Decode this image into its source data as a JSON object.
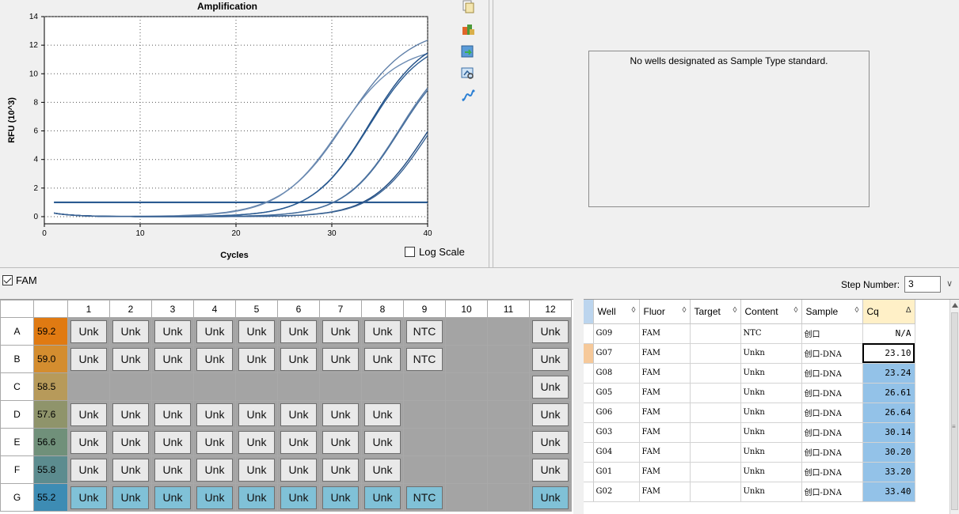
{
  "chart_data": {
    "type": "line",
    "title": "Amplification",
    "xlabel": "Cycles",
    "ylabel": "RFU (10^3)",
    "xlim": [
      0,
      40
    ],
    "ylim": [
      -0.5,
      14
    ],
    "x_ticks": [
      0,
      10,
      20,
      30,
      40
    ],
    "y_ticks": [
      0,
      2,
      4,
      6,
      8,
      10,
      12,
      14
    ],
    "threshold": 1.0,
    "grid": true,
    "series": [
      {
        "cq": 23.1,
        "plateau": 13.3,
        "k": 0.3,
        "color": "#5f7fa8"
      },
      {
        "cq": 23.24,
        "plateau": 12.0,
        "k": 0.32,
        "color": "#6d8cb3"
      },
      {
        "cq": 26.61,
        "plateau": 12.9,
        "k": 0.34,
        "color": "#1f4e86"
      },
      {
        "cq": 26.64,
        "plateau": 12.6,
        "k": 0.34,
        "color": "#2a5b92"
      },
      {
        "cq": 30.14,
        "plateau": 12.2,
        "k": 0.35,
        "color": "#5b7ca6"
      },
      {
        "cq": 30.2,
        "plateau": 12.0,
        "k": 0.35,
        "color": "#456e9d"
      },
      {
        "cq": 33.2,
        "plateau": 11.2,
        "k": 0.36,
        "color": "#1e4a80"
      },
      {
        "cq": 33.4,
        "plateau": 11.0,
        "k": 0.36,
        "color": "#3a6394"
      }
    ]
  },
  "toolbar": {
    "icons": [
      "copy-icon",
      "export-icon",
      "refresh-icon",
      "zoom-icon",
      "curve-icon"
    ]
  },
  "log_scale_label": "Log Scale",
  "standard_message": "No wells designated as Sample Type standard.",
  "fam_label": "FAM",
  "step_label": "Step Number:",
  "step_value": "3",
  "plate": {
    "columns": [
      "1",
      "2",
      "3",
      "4",
      "5",
      "6",
      "7",
      "8",
      "9",
      "10",
      "11",
      "12"
    ],
    "rows": [
      {
        "label": "A",
        "tm": "59.2",
        "tm_color": "#e07a12",
        "wells": [
          "Unk",
          "Unk",
          "Unk",
          "Unk",
          "Unk",
          "Unk",
          "Unk",
          "Unk",
          "NTC",
          "",
          "",
          "Unk"
        ]
      },
      {
        "label": "B",
        "tm": "59.0",
        "tm_color": "#d48d2f",
        "wells": [
          "Unk",
          "Unk",
          "Unk",
          "Unk",
          "Unk",
          "Unk",
          "Unk",
          "Unk",
          "NTC",
          "",
          "",
          "Unk"
        ]
      },
      {
        "label": "C",
        "tm": "58.5",
        "tm_color": "#b79a5a",
        "wells": [
          "",
          "",
          "",
          "",
          "",
          "",
          "",
          "",
          "",
          "",
          "",
          "Unk"
        ]
      },
      {
        "label": "D",
        "tm": "57.6",
        "tm_color": "#8f946b",
        "wells": [
          "Unk",
          "Unk",
          "Unk",
          "Unk",
          "Unk",
          "Unk",
          "Unk",
          "Unk",
          "",
          "",
          "",
          "Unk"
        ]
      },
      {
        "label": "E",
        "tm": "56.6",
        "tm_color": "#70907a",
        "wells": [
          "Unk",
          "Unk",
          "Unk",
          "Unk",
          "Unk",
          "Unk",
          "Unk",
          "Unk",
          "",
          "",
          "",
          "Unk"
        ]
      },
      {
        "label": "F",
        "tm": "55.8",
        "tm_color": "#5c8c8f",
        "wells": [
          "Unk",
          "Unk",
          "Unk",
          "Unk",
          "Unk",
          "Unk",
          "Unk",
          "Unk",
          "",
          "",
          "",
          "Unk"
        ]
      },
      {
        "label": "G",
        "tm": "55.2",
        "tm_color": "#3d8cb4",
        "wells": [
          "Unk",
          "Unk",
          "Unk",
          "Unk",
          "Unk",
          "Unk",
          "Unk",
          "Unk",
          "NTC",
          "",
          "",
          "Unk"
        ]
      }
    ]
  },
  "results": {
    "headers": [
      "Well",
      "Fluor",
      "Target",
      "Content",
      "Sample",
      "Cq"
    ],
    "rows": [
      {
        "well": "G09",
        "fluor": "FAM",
        "target": "",
        "content": "NTC",
        "sample": "创口",
        "cq": "N/A"
      },
      {
        "well": "G07",
        "fluor": "FAM",
        "target": "",
        "content": "Unkn",
        "sample": "创口-DNA",
        "cq": "23.10"
      },
      {
        "well": "G08",
        "fluor": "FAM",
        "target": "",
        "content": "Unkn",
        "sample": "创口-DNA",
        "cq": "23.24"
      },
      {
        "well": "G05",
        "fluor": "FAM",
        "target": "",
        "content": "Unkn",
        "sample": "创口-DNA",
        "cq": "26.61"
      },
      {
        "well": "G06",
        "fluor": "FAM",
        "target": "",
        "content": "Unkn",
        "sample": "创口-DNA",
        "cq": "26.64"
      },
      {
        "well": "G03",
        "fluor": "FAM",
        "target": "",
        "content": "Unkn",
        "sample": "创口-DNA",
        "cq": "30.14"
      },
      {
        "well": "G04",
        "fluor": "FAM",
        "target": "",
        "content": "Unkn",
        "sample": "创口-DNA",
        "cq": "30.20"
      },
      {
        "well": "G01",
        "fluor": "FAM",
        "target": "",
        "content": "Unkn",
        "sample": "创口-DNA",
        "cq": "33.20"
      },
      {
        "well": "G02",
        "fluor": "FAM",
        "target": "",
        "content": "Unkn",
        "sample": "创口-DNA",
        "cq": "33.40"
      }
    ]
  }
}
